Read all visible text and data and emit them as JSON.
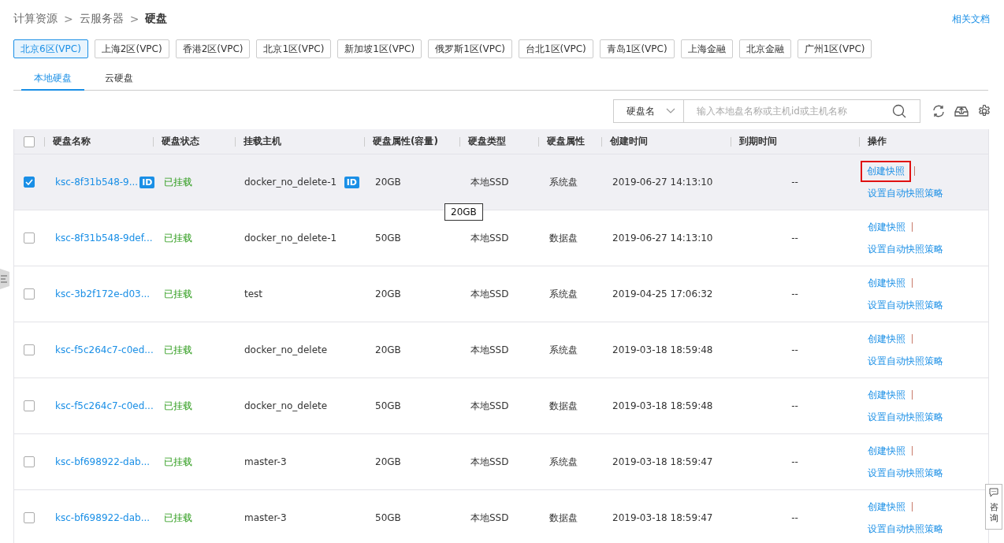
{
  "breadcrumb": [
    {
      "label": "计算资源",
      "current": false
    },
    {
      "label": "云服务器",
      "current": false
    },
    {
      "label": "硬盘",
      "current": true
    }
  ],
  "breadcrumb_separator": ">",
  "docs_link": "相关文档",
  "regions": [
    {
      "label": "北京6区(VPC)",
      "selected": true
    },
    {
      "label": "上海2区(VPC)",
      "selected": false
    },
    {
      "label": "香港2区(VPC)",
      "selected": false
    },
    {
      "label": "北京1区(VPC)",
      "selected": false
    },
    {
      "label": "新加坡1区(VPC)",
      "selected": false
    },
    {
      "label": "俄罗斯1区(VPC)",
      "selected": false
    },
    {
      "label": "台北1区(VPC)",
      "selected": false
    },
    {
      "label": "青岛1区(VPC)",
      "selected": false
    },
    {
      "label": "上海金融",
      "selected": false
    },
    {
      "label": "北京金融",
      "selected": false
    },
    {
      "label": "广州1区(VPC)",
      "selected": false
    }
  ],
  "tabs": [
    {
      "label": "本地硬盘",
      "selected": true
    },
    {
      "label": "云硬盘",
      "selected": false
    }
  ],
  "search": {
    "field_select": "硬盘名",
    "placeholder": "输入本地盘名称或主机id或主机名称"
  },
  "table": {
    "select_all_checked": false,
    "columns": [
      "硬盘名称",
      "硬盘状态",
      "挂载主机",
      "硬盘属性(容量)",
      "硬盘类型",
      "硬盘属性",
      "创建时间",
      "到期时间",
      "操作"
    ],
    "rows": [
      {
        "selected": true,
        "name": "ksc-8f31b548-9...",
        "name_badge": "ID",
        "status": "已挂载",
        "host": "docker_no_delete-1",
        "host_badge": "ID",
        "capacity": "20GB",
        "type": "本地SSD",
        "attribute": "系统盘",
        "created": "2019-06-27 14:13:10",
        "expires": "--",
        "actions": [
          {
            "label": "创建快照",
            "highlighted": true
          },
          {
            "label": "设置自动快照策略",
            "highlighted": false
          }
        ]
      },
      {
        "selected": false,
        "name": "ksc-8f31b548-9def...",
        "status": "已挂载",
        "host": "docker_no_delete-1",
        "capacity": "50GB",
        "type": "本地SSD",
        "attribute": "数据盘",
        "created": "2019-06-27 14:13:10",
        "expires": "--",
        "actions": [
          {
            "label": "创建快照",
            "highlighted": false
          },
          {
            "label": "设置自动快照策略",
            "highlighted": false
          }
        ]
      },
      {
        "selected": false,
        "name": "ksc-3b2f172e-d03...",
        "status": "已挂载",
        "host": "test",
        "capacity": "20GB",
        "type": "本地SSD",
        "attribute": "系统盘",
        "created": "2019-04-25 17:06:32",
        "expires": "--",
        "actions": [
          {
            "label": "创建快照",
            "highlighted": false
          },
          {
            "label": "设置自动快照策略",
            "highlighted": false
          }
        ]
      },
      {
        "selected": false,
        "name": "ksc-f5c264c7-c0ed...",
        "status": "已挂载",
        "host": "docker_no_delete",
        "capacity": "20GB",
        "type": "本地SSD",
        "attribute": "系统盘",
        "created": "2019-03-18 18:59:48",
        "expires": "--",
        "actions": [
          {
            "label": "创建快照",
            "highlighted": false
          },
          {
            "label": "设置自动快照策略",
            "highlighted": false
          }
        ]
      },
      {
        "selected": false,
        "name": "ksc-f5c264c7-c0ed...",
        "status": "已挂载",
        "host": "docker_no_delete",
        "capacity": "50GB",
        "type": "本地SSD",
        "attribute": "数据盘",
        "created": "2019-03-18 18:59:48",
        "expires": "--",
        "actions": [
          {
            "label": "创建快照",
            "highlighted": false
          },
          {
            "label": "设置自动快照策略",
            "highlighted": false
          }
        ]
      },
      {
        "selected": false,
        "name": "ksc-bf698922-dab...",
        "status": "已挂载",
        "host": "master-3",
        "capacity": "20GB",
        "type": "本地SSD",
        "attribute": "系统盘",
        "created": "2019-03-18 18:59:47",
        "expires": "--",
        "actions": [
          {
            "label": "创建快照",
            "highlighted": false
          },
          {
            "label": "设置自动快照策略",
            "highlighted": false
          }
        ]
      },
      {
        "selected": false,
        "name": "ksc-bf698922-dab...",
        "status": "已挂载",
        "host": "master-3",
        "capacity": "50GB",
        "type": "本地SSD",
        "attribute": "数据盘",
        "created": "2019-03-18 18:59:47",
        "expires": "--",
        "actions": [
          {
            "label": "创建快照",
            "highlighted": false
          },
          {
            "label": "设置自动快照策略",
            "highlighted": false
          }
        ]
      }
    ]
  },
  "tooltip": {
    "text": "20GB"
  },
  "consult_button": {
    "label": "咨询"
  }
}
